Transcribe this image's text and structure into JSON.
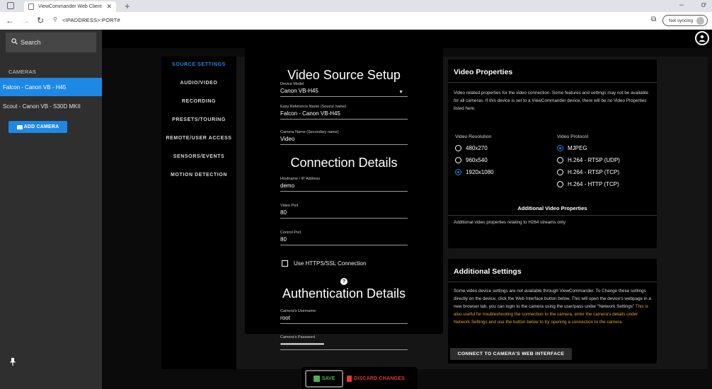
{
  "browser": {
    "tab_title": "ViewCommander Web Client",
    "url": "<IPADDRESS>:PORT#",
    "sync_label": "Not syncing"
  },
  "sidebar": {
    "search_placeholder": "Search",
    "cameras_heading": "CAMERAS",
    "cameras": [
      {
        "label": "Falcon - Canon VB - H45",
        "active": true
      },
      {
        "label": "Scout - Canon VB - S30D MKII",
        "active": false
      }
    ],
    "add_camera_label": "ADD CAMERA"
  },
  "settings_nav": {
    "items": [
      {
        "label": "SOURCE SETTINGS",
        "active": true
      },
      {
        "label": "AUDIO/VIDEO"
      },
      {
        "label": "RECORDING"
      },
      {
        "label": "PRESETS/TOURING"
      },
      {
        "label": "REMOTE/USER ACCESS"
      },
      {
        "label": "SENSORS/EVENTS"
      },
      {
        "label": "MOTION DETECTION"
      }
    ]
  },
  "form": {
    "video_source_heading": "Video Source Setup",
    "device_model": {
      "label": "Device Model",
      "value": "Canon VB-H45"
    },
    "reference_name": {
      "label": "Easy Reference Name (Source name)",
      "value": "Falcon - Canon VB-H45"
    },
    "camera_name": {
      "label": "Camera Name (Secondary name)",
      "value": "Video"
    },
    "connection_heading": "Connection Details",
    "hostname": {
      "label": "Hostname / IP Address",
      "value": "demo"
    },
    "video_port": {
      "label": "Video Port",
      "value": "80"
    },
    "control_port": {
      "label": "Control Port",
      "value": "80"
    },
    "https_label": "Use HTTPS/SSL Connection",
    "auth_heading": "Authentication Details",
    "username": {
      "label": "Camera's Username",
      "value": "root"
    },
    "password": {
      "label": "Camera's Password",
      "value": "••••••••••••••••••••••••••••••••••"
    }
  },
  "video_properties": {
    "title": "Video Properties",
    "description": "Video related properties for the video connection. Some features and settings may not be available for all cameras. If this device is set to a ViewCommander device, there will be no Video Properties listed here.",
    "resolution_label": "Video Resolution",
    "resolutions": [
      {
        "label": "480x270",
        "selected": false
      },
      {
        "label": "960x540",
        "selected": false
      },
      {
        "label": "1920x1080",
        "selected": true
      }
    ],
    "protocol_label": "Video Protocol",
    "protocols": [
      {
        "label": "MJPEG",
        "selected": true
      },
      {
        "label": "H.264 - RTSP (UDP)",
        "selected": false
      },
      {
        "label": "H.264 - RTSP (TCP)",
        "selected": false
      },
      {
        "label": "H.264 - HTTP (TCP)",
        "selected": false
      }
    ],
    "additional_heading": "Additional Video Properties",
    "additional_text": "Additional video properties relating to H264 streams only"
  },
  "additional_settings": {
    "title": "Additional Settings",
    "text_normal": "Some video device settings are not available through ViewCommander. To Change these settings directly on the device, click the Web Interface button below. This will open the device's webpage in a new browser tab, you can login to the camera using the user/pass under \"Network Settings\"",
    "text_warning": " This is also useful for troubleshooting the connection to the camera, enter the camera's details under Network Settings and use the button below to try opening a connection to the camera.",
    "web_button_label": "CONNECT TO CAMERA'S WEB INTERFACE"
  },
  "footer": {
    "save_label": "SAVE",
    "discard_label": "DISCARD CHANGES"
  },
  "colors": {
    "accent": "#1e88e5",
    "save": "#4caf50",
    "discard": "#e53935",
    "warning_text": "#e5a134"
  }
}
